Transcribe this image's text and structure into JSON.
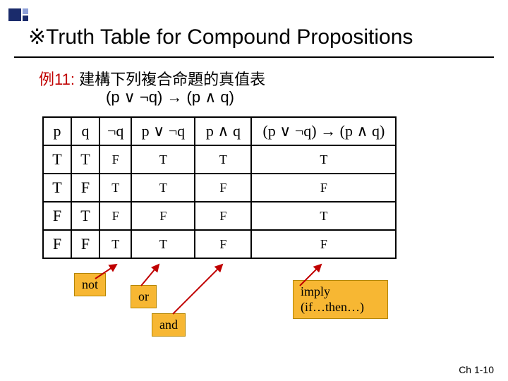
{
  "title": "※Truth Table for Compound Propositions",
  "example": {
    "label": "例11:",
    "text": "建構下列複合命題的真值表"
  },
  "expression": "(p ∨ ¬q)  →  (p ∧ q)",
  "table": {
    "headers": {
      "p": "p",
      "q": "q",
      "nq": "¬q",
      "pvnq": "p ∨ ¬q",
      "paq": "p ∧ q",
      "imp": "(p ∨ ¬q) → (p ∧ q)"
    },
    "rows": [
      {
        "p": "T",
        "q": "T",
        "nq": "F",
        "pvnq": "T",
        "paq": "T",
        "imp": "T"
      },
      {
        "p": "T",
        "q": "F",
        "nq": "T",
        "pvnq": "T",
        "paq": "F",
        "imp": "F"
      },
      {
        "p": "F",
        "q": "T",
        "nq": "F",
        "pvnq": "F",
        "paq": "F",
        "imp": "T"
      },
      {
        "p": "F",
        "q": "F",
        "nq": "T",
        "pvnq": "T",
        "paq": "F",
        "imp": "F"
      }
    ]
  },
  "tags": {
    "not": "not",
    "or": "or",
    "and": "and",
    "imply": "imply\n(if…then…)"
  },
  "footer": "Ch 1-10",
  "chart_data": {
    "type": "table",
    "title": "Truth Table for (p ∨ ¬q) → (p ∧ q)",
    "columns": [
      "p",
      "q",
      "¬q",
      "p ∨ ¬q",
      "p ∧ q",
      "(p ∨ ¬q) → (p ∧ q)"
    ],
    "rows": [
      [
        "T",
        "T",
        "F",
        "T",
        "T",
        "T"
      ],
      [
        "T",
        "F",
        "T",
        "T",
        "F",
        "F"
      ],
      [
        "F",
        "T",
        "F",
        "F",
        "F",
        "T"
      ],
      [
        "F",
        "F",
        "T",
        "T",
        "F",
        "F"
      ]
    ]
  }
}
